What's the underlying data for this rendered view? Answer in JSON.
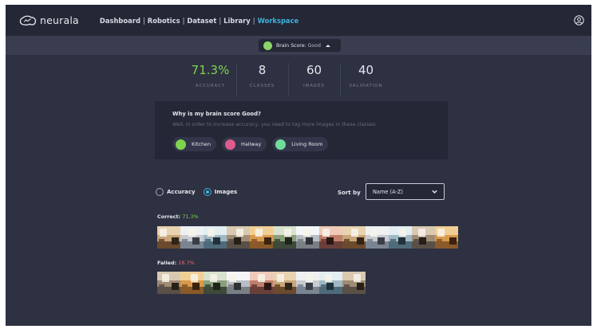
{
  "app": {
    "logo_text": "neurala"
  },
  "nav": {
    "items": [
      {
        "label": "Dashboard",
        "active": false
      },
      {
        "label": "Robotics",
        "active": false
      },
      {
        "label": "Dataset",
        "active": false
      },
      {
        "label": "Library",
        "active": false
      },
      {
        "label": "Workspace",
        "active": true
      }
    ],
    "separator": "|"
  },
  "brain_score": {
    "label": "Brain Score:",
    "value": "Good",
    "color": "#8bd566"
  },
  "stats": [
    {
      "value": "71.3%",
      "label": "ACCURACY"
    },
    {
      "value": "8",
      "label": "CLASSES"
    },
    {
      "value": "60",
      "label": "IMAGES"
    },
    {
      "value": "40",
      "label": "VALIDATION"
    }
  ],
  "why": {
    "title": "Why is my brain score Good?",
    "subtitle": "Well, in order to increase accuracy, you need to tag more images in these classes:",
    "classes": [
      {
        "label": "Kitchen",
        "color": "#7fd34e"
      },
      {
        "label": "Hallway",
        "color": "#e05a8c"
      },
      {
        "label": "Living Room",
        "color": "#6fdc9c"
      }
    ]
  },
  "view": {
    "options": [
      {
        "label": "Accuracy",
        "checked": false
      },
      {
        "label": "Images",
        "checked": true
      }
    ],
    "sort_label": "Sort by",
    "sort_value": "Name (A-Z)"
  },
  "correct": {
    "label": "Correct:",
    "percent": "71.3%",
    "thumbnail_count": 13
  },
  "failed": {
    "label": "Failed:",
    "percent": "28.7%",
    "thumbnail_count": 9
  },
  "colors": {
    "accent": "#3db3dc",
    "good": "#7fd34e",
    "fail": "#e56a6a",
    "header_bg": "#242735",
    "panel_bg": "#2e3142"
  }
}
